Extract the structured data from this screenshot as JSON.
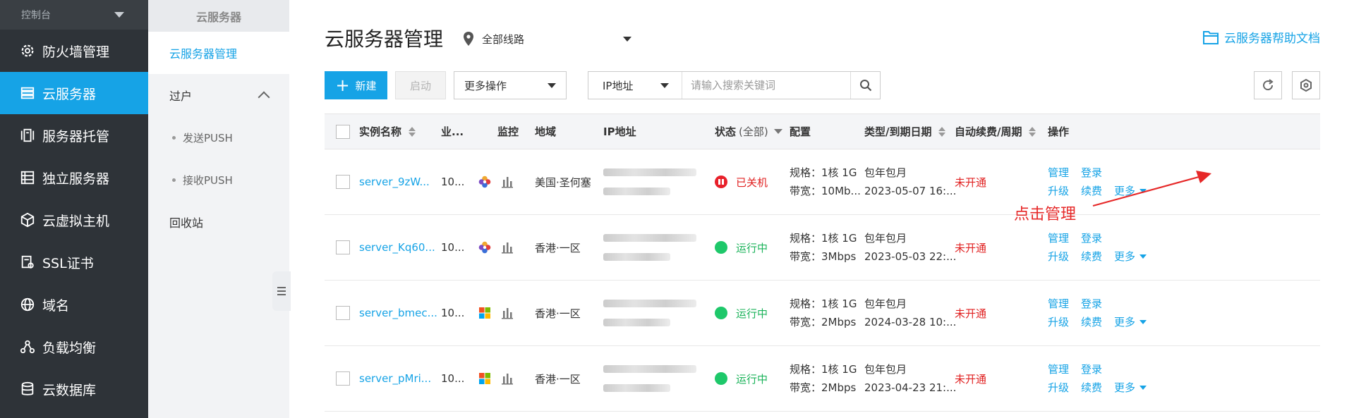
{
  "sidebar": {
    "top_label": "控制台",
    "items": [
      {
        "label": "防火墙管理",
        "icon": "gear-icon",
        "active": false
      },
      {
        "label": "云服务器",
        "icon": "server-stack-icon",
        "active": true
      },
      {
        "label": "服务器托管",
        "icon": "server-hosting-icon",
        "active": false
      },
      {
        "label": "独立服务器",
        "icon": "dedicated-server-icon",
        "active": false
      },
      {
        "label": "云虚拟主机",
        "icon": "cube-icon",
        "active": false
      },
      {
        "label": "SSL证书",
        "icon": "certificate-icon",
        "active": false
      },
      {
        "label": "域名",
        "icon": "globe-icon",
        "active": false
      },
      {
        "label": "负载均衡",
        "icon": "load-balance-icon",
        "active": false
      },
      {
        "label": "云数据库",
        "icon": "database-icon",
        "active": false
      }
    ]
  },
  "subnav": {
    "header": "云服务器",
    "items": {
      "manage": "云服务器管理",
      "transfer": "过户",
      "send_push": "发送PUSH",
      "receive_push": "接收PUSH",
      "recycle": "回收站"
    }
  },
  "header": {
    "title": "云服务器管理",
    "route": "全部线路",
    "help": "云服务器帮助文档"
  },
  "toolbar": {
    "new": "新建",
    "start": "启动",
    "more_ops": "更多操作",
    "search_type": "IP地址",
    "search_placeholder": "请输入搜索关键词"
  },
  "table": {
    "columns": {
      "name": "实例名称",
      "business": "业...",
      "monitor": "监控",
      "region": "地域",
      "ip": "IP地址",
      "status": "状态",
      "status_filter": "(全部)",
      "config": "配置",
      "type_expiry": "类型/到期日期",
      "auto_renew": "自动续费/周期",
      "ops": "操作"
    },
    "rows": [
      {
        "name": "server_9zW...",
        "business": "10...",
        "os": "generic-os-icon",
        "region": "美国·圣何塞",
        "status": "已关机",
        "status_type": "stopped",
        "spec": "规格：1核 1G",
        "bandwidth": "带宽：10Mb...",
        "type": "包年包月",
        "expiry": "2023-05-07 16:...",
        "auto_renew": "未开通"
      },
      {
        "name": "server_Kq60...",
        "business": "10...",
        "os": "generic-os-icon",
        "region": "香港·一区",
        "status": "运行中",
        "status_type": "running",
        "spec": "规格：1核 1G",
        "bandwidth": "带宽：3Mbps",
        "type": "包年包月",
        "expiry": "2023-05-03 22:...",
        "auto_renew": "未开通"
      },
      {
        "name": "server_bmec...",
        "business": "10...",
        "os": "windows-icon",
        "region": "香港·一区",
        "status": "运行中",
        "status_type": "running",
        "spec": "规格：1核 1G",
        "bandwidth": "带宽：2Mbps",
        "type": "包年包月",
        "expiry": "2024-03-28 10:...",
        "auto_renew": "未开通"
      },
      {
        "name": "server_pMri...",
        "business": "10...",
        "os": "windows-icon",
        "region": "香港·一区",
        "status": "运行中",
        "status_type": "running",
        "spec": "规格：1核 1G",
        "bandwidth": "带宽：2Mbps",
        "type": "包年包月",
        "expiry": "2023-04-23 21:...",
        "auto_renew": "未开通"
      }
    ],
    "ops": {
      "manage": "管理",
      "login": "登录",
      "upgrade": "升级",
      "renew": "续费",
      "more": "更多"
    }
  },
  "annotation": {
    "text": "点击管理"
  },
  "colors": {
    "accent": "#16a3e6",
    "sidebar_bg": "#2e3338",
    "danger": "#e02020",
    "success": "#1bb35a"
  }
}
